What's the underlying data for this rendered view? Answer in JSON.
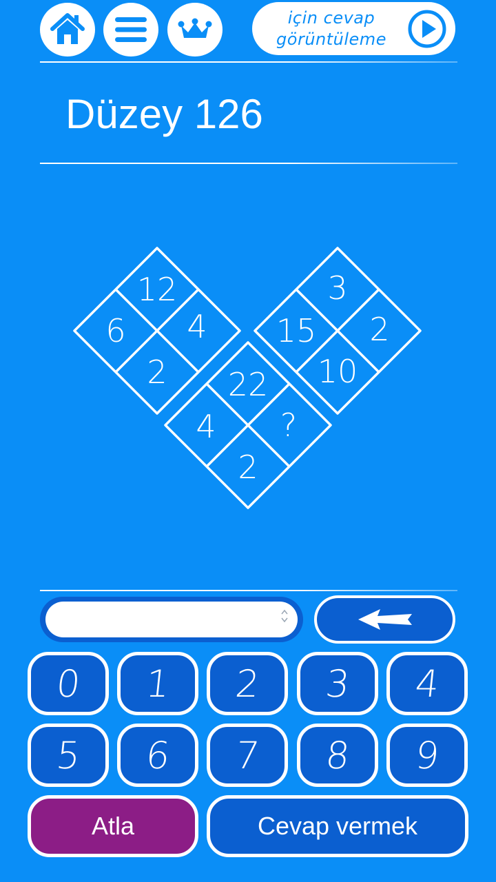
{
  "header": {
    "home_icon": "home-icon",
    "menu_icon": "menu-icon",
    "crown_icon": "crown-icon",
    "answer_button": {
      "line1": "için cevap",
      "line2": "görüntüleme",
      "icon": "play-icon"
    }
  },
  "level": {
    "title": "Düzey 126"
  },
  "puzzle": {
    "diamonds": [
      {
        "name": "left",
        "top": "12",
        "left": "6",
        "right": "4",
        "bottom": "2"
      },
      {
        "name": "right",
        "top": "3",
        "left": "15",
        "right": "2",
        "bottom": "10"
      },
      {
        "name": "middle",
        "top": "22",
        "left": "4",
        "right": "?",
        "bottom": "2"
      }
    ]
  },
  "input": {
    "value": "",
    "placeholder": ""
  },
  "backspace_icon": "backspace-arrow-icon",
  "keypad": {
    "keys": [
      "0",
      "1",
      "2",
      "3",
      "4",
      "5",
      "6",
      "7",
      "8",
      "9"
    ],
    "skip_label": "Atla",
    "submit_label": "Cevap vermek"
  },
  "colors": {
    "background": "#0a8ef7",
    "button": "#0b5fd0",
    "skip": "#8c1d86",
    "white": "#ffffff"
  }
}
